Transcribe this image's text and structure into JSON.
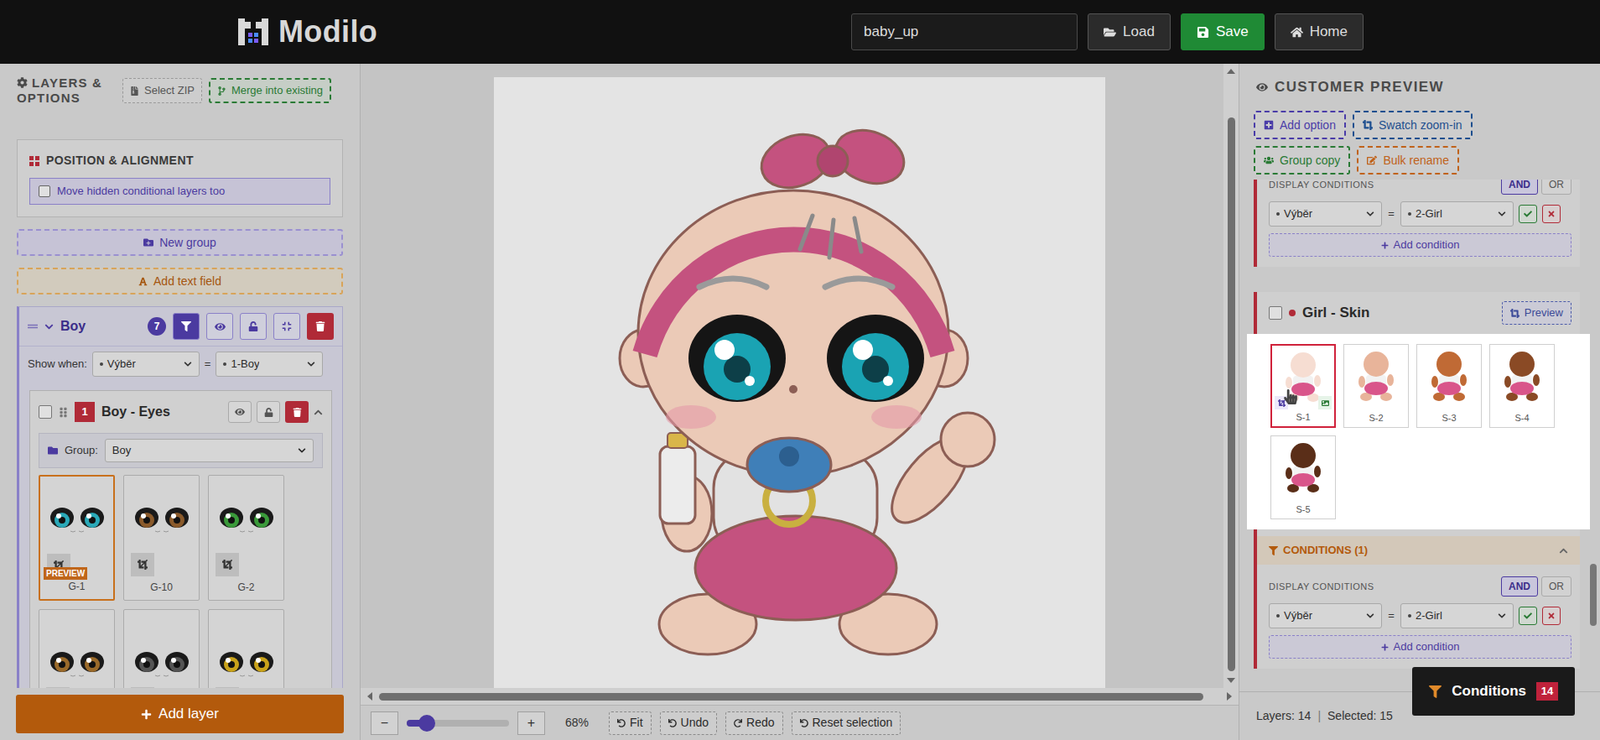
{
  "topbar": {
    "logo": "Modilo",
    "project_name": "baby_up",
    "buttons": [
      {
        "label": "Load",
        "kind": "load"
      },
      {
        "label": "Save",
        "kind": "save"
      },
      {
        "label": "Home",
        "kind": "home"
      }
    ]
  },
  "left_panel": {
    "title": "LAYERS & OPTIONS",
    "buttons": [
      {
        "label": "Select ZIP",
        "kind": "file"
      },
      {
        "label": "Merge into existing",
        "kind": "merge"
      }
    ],
    "position_card": {
      "title": "POSITION & ALIGNMENT",
      "checkbox": {
        "label": "Move hidden conditional layers too",
        "checked": false
      }
    },
    "new_group": "New group",
    "add_text_field": "Add text field",
    "group": {
      "name": "Boy",
      "count": "7",
      "expanded": true,
      "filter_active": true,
      "show_when_label": "Show when:",
      "field": "Výběr",
      "operator": "=",
      "value": "1-Boy"
    },
    "layer": {
      "number": "1",
      "name": "Boy - Eyes",
      "checked": false,
      "expanded": true,
      "group_label": "Group:",
      "group_value": "Boy",
      "thumbnails": [
        {
          "label": "G-1",
          "selected": true,
          "badge": "PREVIEW",
          "color": "#2aa9b8"
        },
        {
          "label": "G-10",
          "selected": false,
          "badge": "",
          "color": "#8a5a2b"
        },
        {
          "label": "G-2",
          "selected": false,
          "badge": "",
          "color": "#3a9a3a"
        },
        {
          "label": "",
          "selected": false,
          "badge": "",
          "color": "#9a6a2a"
        },
        {
          "label": "",
          "selected": false,
          "badge": "",
          "color": "#555555"
        },
        {
          "label": "",
          "selected": false,
          "badge": "",
          "color": "#c9a21a"
        }
      ]
    },
    "add_layer": "Add layer"
  },
  "canvas": {
    "zoom_out": "−",
    "zoom_in": "+",
    "zoom_level": 0.2,
    "zoom": "68%",
    "buttons": [
      {
        "label": "Fit",
        "kind": "fit"
      },
      {
        "label": "Undo",
        "kind": "undo"
      },
      {
        "label": "Redo",
        "kind": "redo"
      },
      {
        "label": "Reset selection",
        "kind": "reset"
      }
    ]
  },
  "right_panel": {
    "title": "CUSTOMER PREVIEW",
    "buttons": [
      {
        "label": "Add option",
        "kind": "add",
        "color": "#4a3ca8"
      },
      {
        "label": "Swatch zoom-in",
        "kind": "zoom",
        "color": "#1e4f8f"
      },
      {
        "label": "Group copy",
        "kind": "copy",
        "color": "#2a7a35"
      },
      {
        "label": "Bulk rename",
        "kind": "rename",
        "color": "#c0621a"
      }
    ],
    "previous_card": {
      "conditions_label": "DISPLAY CONDITIONS",
      "logic": [
        {
          "label": "AND",
          "selected": true
        },
        {
          "label": "OR",
          "selected": false
        }
      ],
      "condition": {
        "field": "Výběr",
        "operator": "=",
        "value": "2-Girl"
      },
      "add_condition": "Add condition"
    },
    "card": {
      "title": "Girl - Skin",
      "checked": false,
      "preview_button": "Preview",
      "swatches": [
        {
          "label": "S-1",
          "selected": true,
          "color": "#f6ddd2"
        },
        {
          "label": "S-2",
          "selected": false,
          "color": "#e8b49a"
        },
        {
          "label": "S-3",
          "selected": false,
          "color": "#c06a35"
        },
        {
          "label": "S-4",
          "selected": false,
          "color": "#8a4a25"
        },
        {
          "label": "S-5",
          "selected": false,
          "color": "#5a2e18"
        }
      ],
      "conditions_header": "CONDITIONS (1)",
      "conditions_expanded": true,
      "conditions_label": "DISPLAY CONDITIONS",
      "logic": [
        {
          "label": "AND",
          "selected": true
        },
        {
          "label": "OR",
          "selected": false
        }
      ],
      "condition": {
        "field": "Výběr",
        "operator": "=",
        "value": "2-Girl"
      },
      "add_condition": "Add condition"
    }
  },
  "status_bar": {
    "layers": "Layers: 14",
    "separator": "|",
    "selected": "Selected: 15"
  },
  "conditions_button": {
    "label": "Conditions",
    "count": "14"
  }
}
